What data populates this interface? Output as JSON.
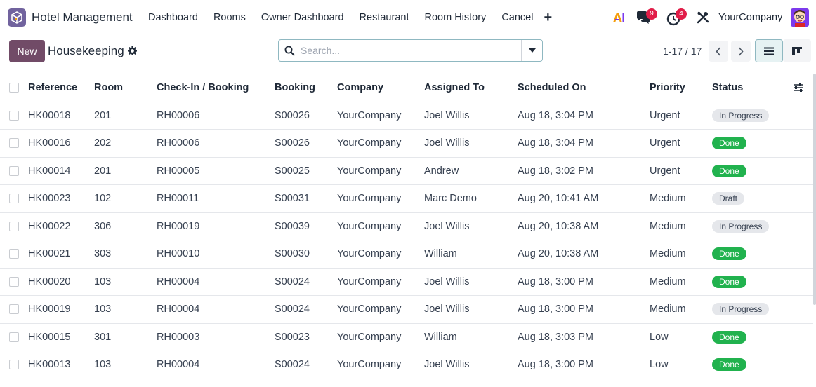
{
  "navbar": {
    "app_title": "Hotel Management",
    "menu": [
      "Dashboard",
      "Rooms",
      "Owner Dashboard",
      "Restaurant",
      "Room History",
      "Cancel"
    ],
    "plus_label": "+",
    "messages_count": "9",
    "activities_count": "4",
    "company": "YourCompany",
    "icons": [
      "app-logo-icon",
      "ai-icon",
      "chat-icon",
      "clock-icon",
      "tools-icon",
      "avatar"
    ]
  },
  "control": {
    "new_label": "New",
    "title": "Housekeeping",
    "search_placeholder": "Search...",
    "pager": "1-17 / 17"
  },
  "colors": {
    "brand": "#714b67",
    "done": "#21b24e",
    "badge": "#e11d48",
    "accent": "#8fb8c1"
  },
  "table": {
    "columns": [
      "Reference",
      "Room",
      "Check-In / Booking",
      "Booking",
      "Company",
      "Assigned To",
      "Scheduled On",
      "Priority",
      "Status"
    ],
    "rows": [
      {
        "ref": "HK00018",
        "room": "201",
        "checkin": "RH00006",
        "booking": "S00026",
        "company": "YourCompany",
        "assigned": "Joel Willis",
        "scheduled": "Aug 18, 3:04 PM",
        "priority": "Urgent",
        "status": "In Progress"
      },
      {
        "ref": "HK00016",
        "room": "202",
        "checkin": "RH00006",
        "booking": "S00026",
        "company": "YourCompany",
        "assigned": "Joel Willis",
        "scheduled": "Aug 18, 3:04 PM",
        "priority": "Urgent",
        "status": "Done"
      },
      {
        "ref": "HK00014",
        "room": "201",
        "checkin": "RH00005",
        "booking": "S00025",
        "company": "YourCompany",
        "assigned": "Andrew",
        "scheduled": "Aug 18, 3:02 PM",
        "priority": "Urgent",
        "status": "Done"
      },
      {
        "ref": "HK00023",
        "room": "102",
        "checkin": "RH00011",
        "booking": "S00031",
        "company": "YourCompany",
        "assigned": "Marc Demo",
        "scheduled": "Aug 20, 10:41 AM",
        "priority": "Medium",
        "status": "Draft"
      },
      {
        "ref": "HK00022",
        "room": "306",
        "checkin": "RH00019",
        "booking": "S00039",
        "company": "YourCompany",
        "assigned": "Joel Willis",
        "scheduled": "Aug 20, 10:38 AM",
        "priority": "Medium",
        "status": "In Progress"
      },
      {
        "ref": "HK00021",
        "room": "303",
        "checkin": "RH00010",
        "booking": "S00030",
        "company": "YourCompany",
        "assigned": "William",
        "scheduled": "Aug 20, 10:38 AM",
        "priority": "Medium",
        "status": "Done"
      },
      {
        "ref": "HK00020",
        "room": "103",
        "checkin": "RH00004",
        "booking": "S00024",
        "company": "YourCompany",
        "assigned": "Joel Willis",
        "scheduled": "Aug 18, 3:00 PM",
        "priority": "Medium",
        "status": "Done"
      },
      {
        "ref": "HK00019",
        "room": "103",
        "checkin": "RH00004",
        "booking": "S00024",
        "company": "YourCompany",
        "assigned": "Joel Willis",
        "scheduled": "Aug 18, 3:00 PM",
        "priority": "Medium",
        "status": "In Progress"
      },
      {
        "ref": "HK00015",
        "room": "301",
        "checkin": "RH00003",
        "booking": "S00023",
        "company": "YourCompany",
        "assigned": "William",
        "scheduled": "Aug 18, 3:03 PM",
        "priority": "Low",
        "status": "Done"
      },
      {
        "ref": "HK00013",
        "room": "103",
        "checkin": "RH00004",
        "booking": "S00024",
        "company": "YourCompany",
        "assigned": "Joel Willis",
        "scheduled": "Aug 18, 3:00 PM",
        "priority": "Low",
        "status": "Done"
      }
    ]
  }
}
